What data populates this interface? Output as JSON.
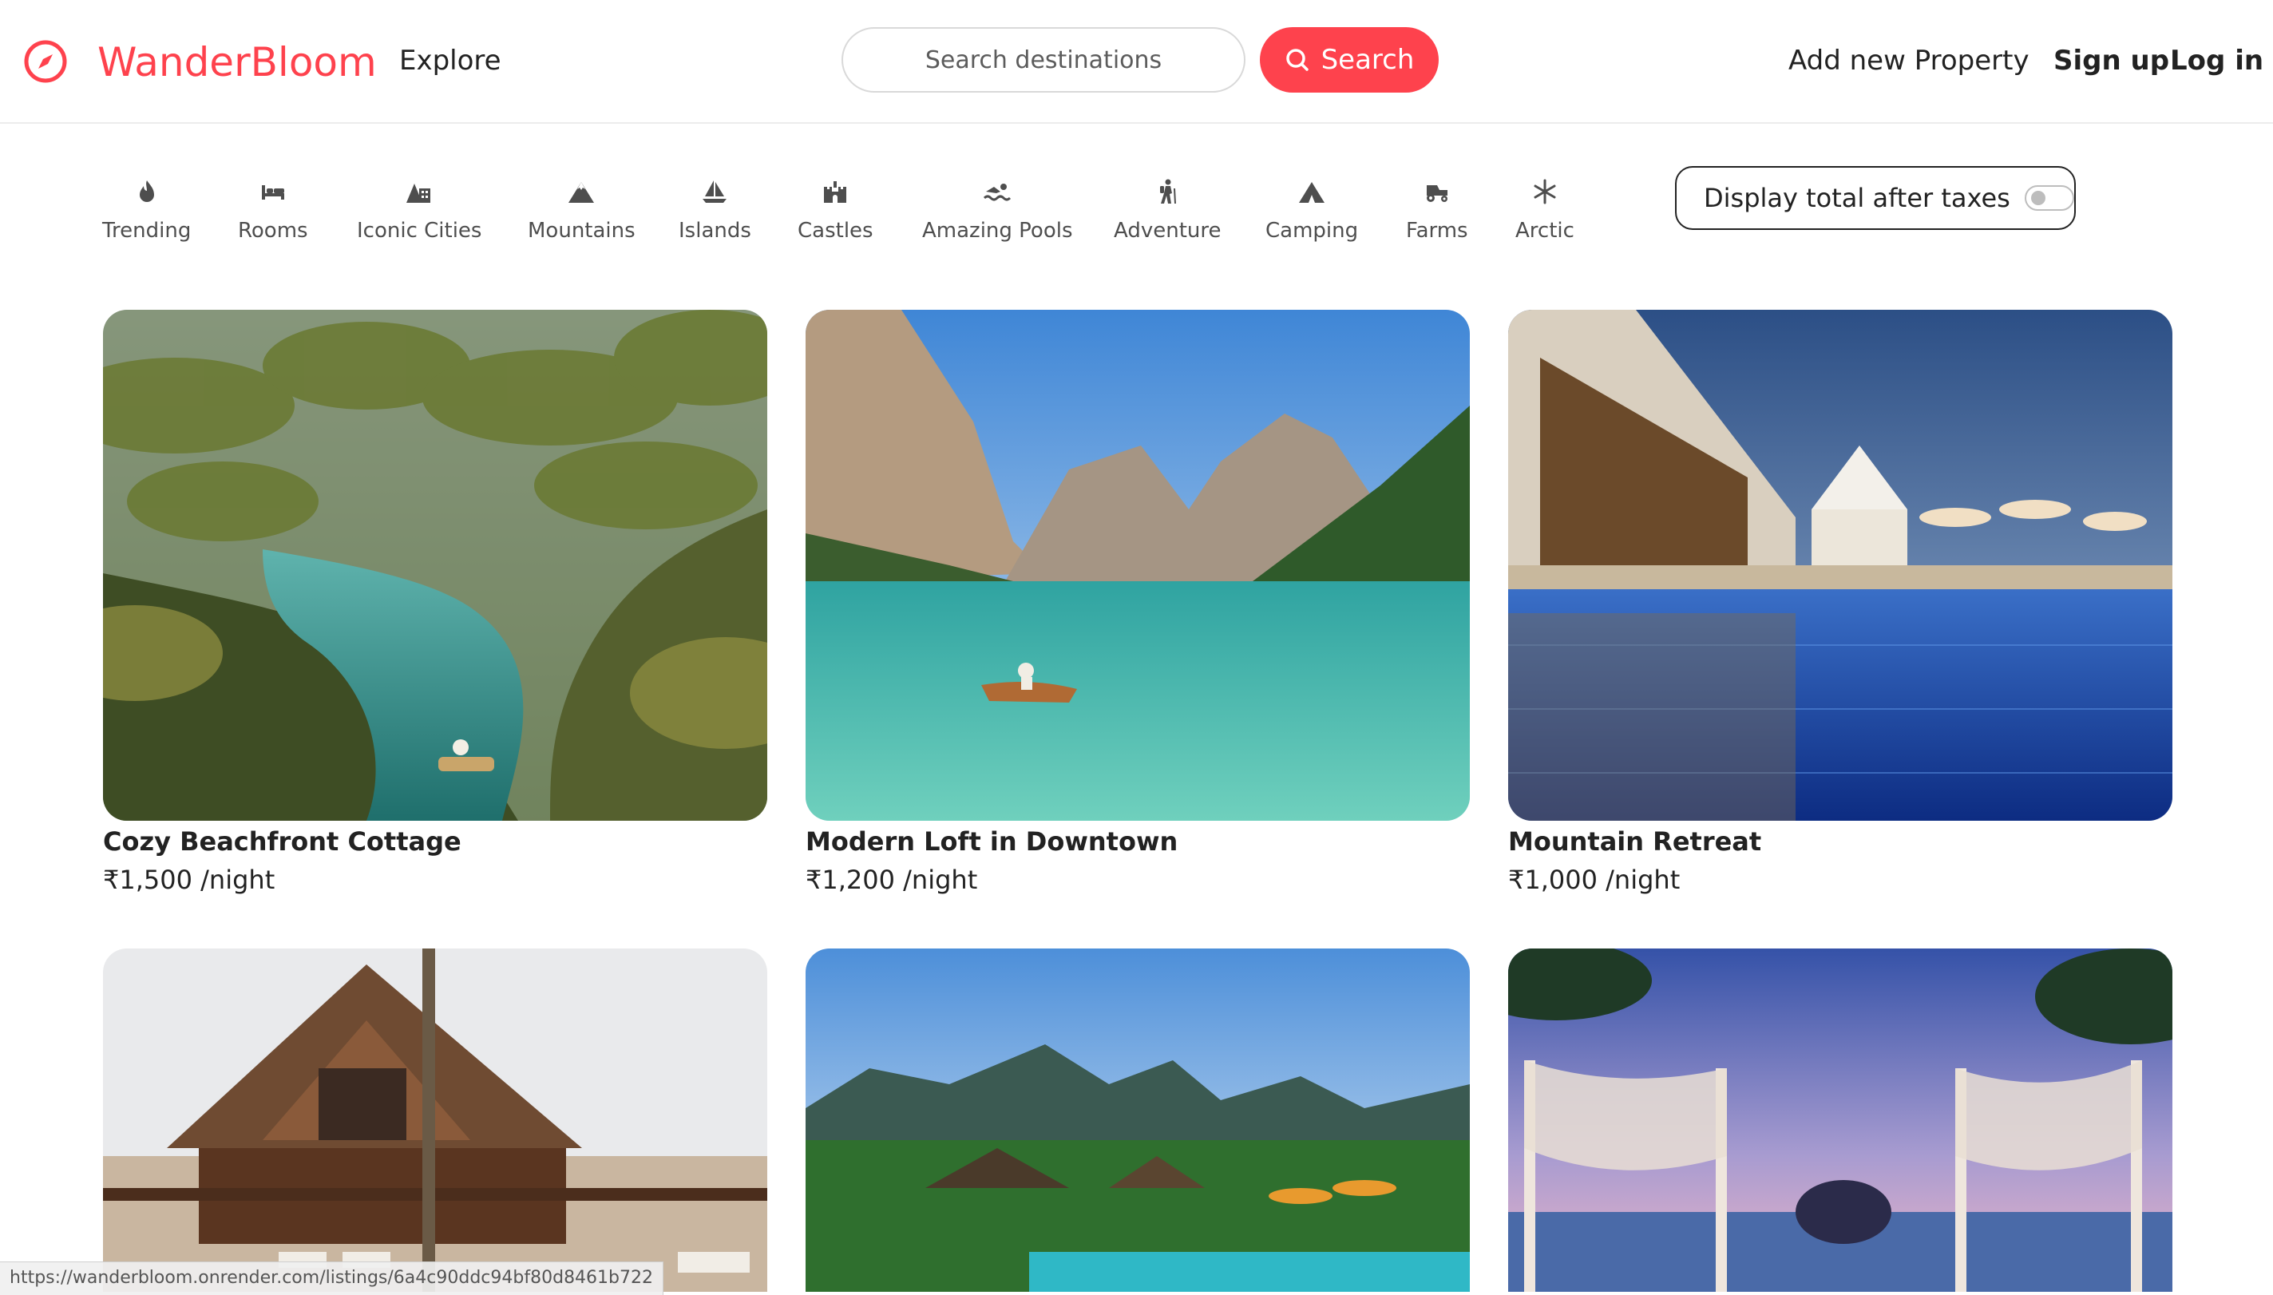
{
  "brand": {
    "name": "WanderBloom",
    "color": "#fe424d",
    "icon": "compass-icon"
  },
  "nav": {
    "explore": "Explore",
    "add_property": "Add new Property",
    "sign_up": "Sign up",
    "log_in": "Log in"
  },
  "search": {
    "placeholder": "Search destinations",
    "button_label": "Search",
    "button_icon": "search-icon"
  },
  "filters": [
    {
      "label": "Trending",
      "icon": "fire-icon"
    },
    {
      "label": "Rooms",
      "icon": "bed-icon"
    },
    {
      "label": "Iconic Cities",
      "icon": "city-icon"
    },
    {
      "label": "Mountains",
      "icon": "mountain-icon"
    },
    {
      "label": "Islands",
      "icon": "sailboat-icon"
    },
    {
      "label": "Castles",
      "icon": "castle-icon"
    },
    {
      "label": "Amazing Pools",
      "icon": "swimmer-icon"
    },
    {
      "label": "Adventure",
      "icon": "hiker-icon"
    },
    {
      "label": "Camping",
      "icon": "tent-icon"
    },
    {
      "label": "Farms",
      "icon": "tractor-icon"
    },
    {
      "label": "Arctic",
      "icon": "snowflake-icon"
    }
  ],
  "tax_toggle": {
    "label": "Display total after taxes",
    "enabled": false
  },
  "listings": [
    {
      "title": "Cozy Beachfront Cottage",
      "currency": "₹",
      "price": "1,500",
      "unit": " /night"
    },
    {
      "title": "Modern Loft in Downtown",
      "currency": "₹",
      "price": "1,200",
      "unit": " /night"
    },
    {
      "title": "Mountain Retreat",
      "currency": "₹",
      "price": "1,000",
      "unit": " /night"
    },
    {
      "title": "",
      "currency": "",
      "price": "",
      "unit": ""
    },
    {
      "title": "",
      "currency": "",
      "price": "",
      "unit": ""
    },
    {
      "title": "",
      "currency": "",
      "price": "",
      "unit": ""
    }
  ],
  "status_bar": {
    "url": "https://wanderbloom.onrender.com/listings/6a4c90ddc94bf80d8461b722"
  }
}
